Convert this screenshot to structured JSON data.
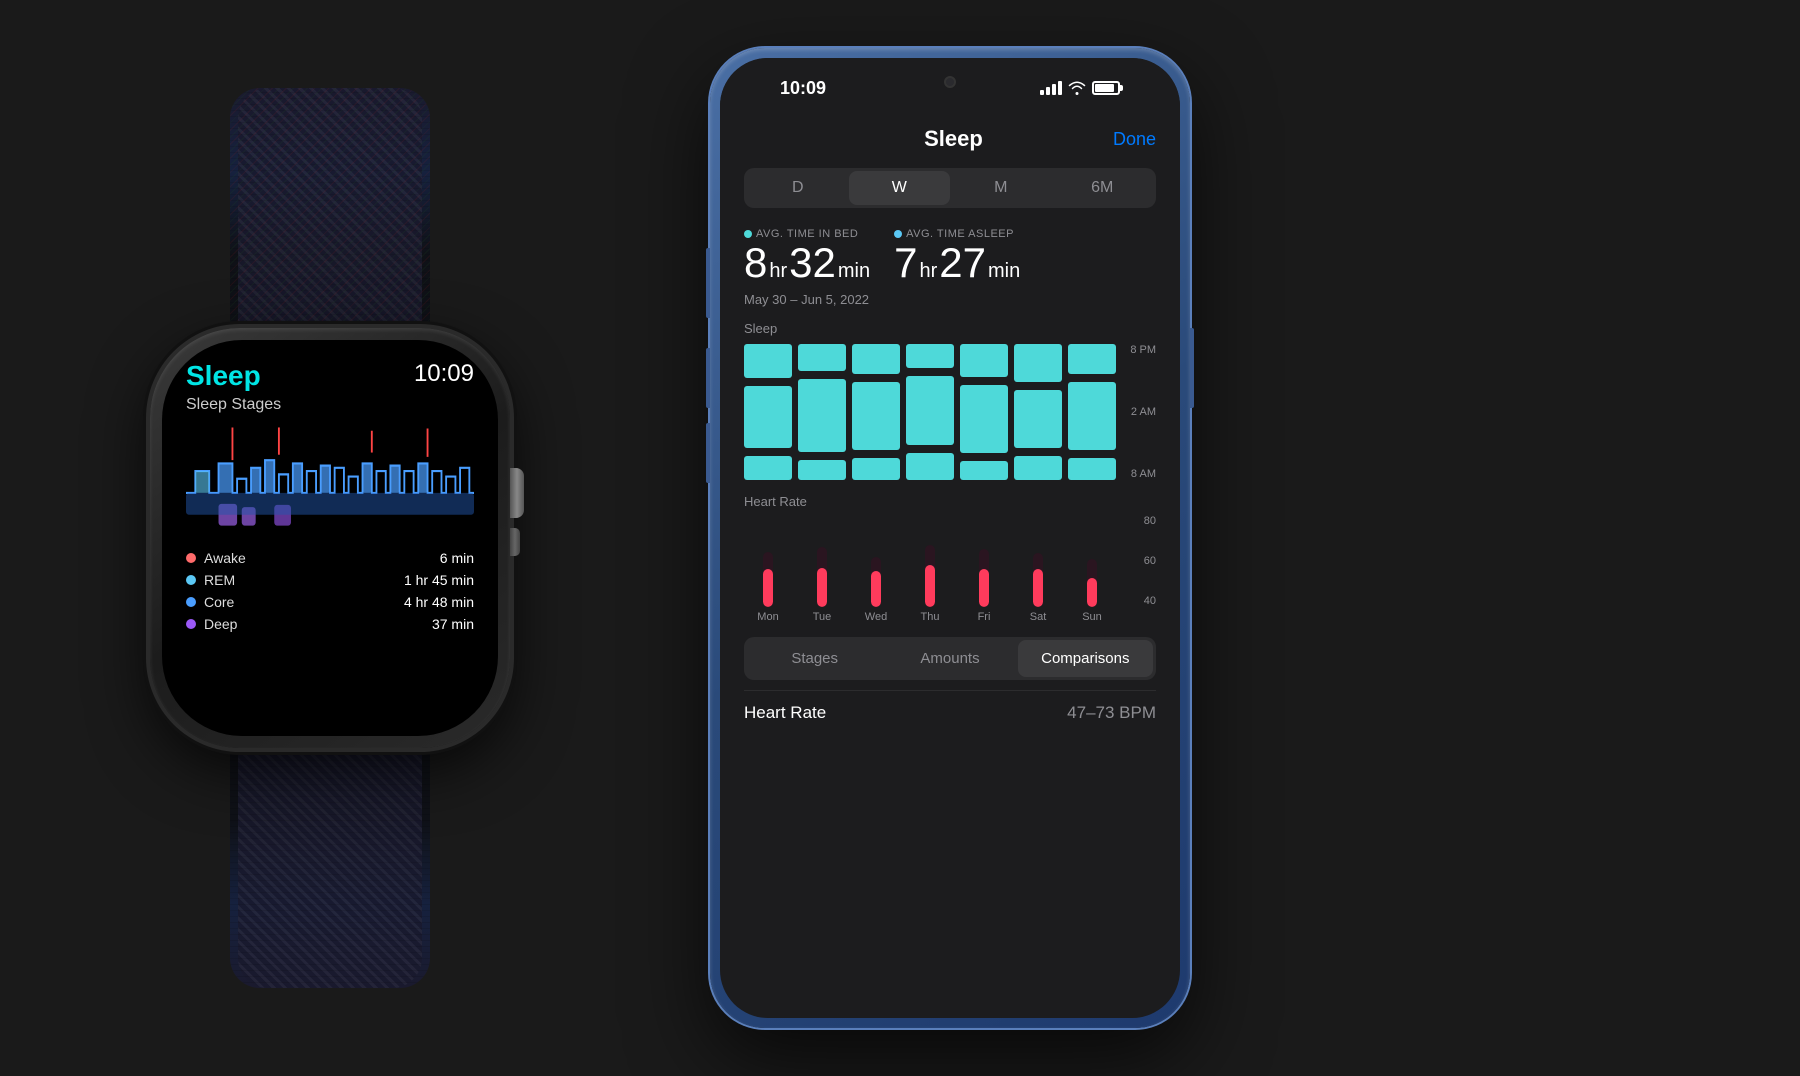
{
  "background": "#1a1a1a",
  "watch": {
    "title": "Sleep",
    "time": "10:09",
    "subtitle": "Sleep Stages",
    "legend": [
      {
        "id": "awake",
        "label": "Awake",
        "value": "6 min",
        "color": "#ff6b6b"
      },
      {
        "id": "rem",
        "label": "REM",
        "value": "1 hr 45 min",
        "color": "#5bc8f5"
      },
      {
        "id": "core",
        "label": "Core",
        "value": "4 hr 48 min",
        "color": "#4a9eff"
      },
      {
        "id": "deep",
        "label": "Deep",
        "value": "37 min",
        "color": "#9b59f7"
      }
    ]
  },
  "phone": {
    "status_time": "10:09",
    "nav_title": "Sleep",
    "nav_done": "Done",
    "segments": [
      "D",
      "W",
      "M",
      "6M"
    ],
    "active_segment": "W",
    "avg_time_in_bed_label": "AVG. TIME IN BED",
    "avg_time_in_bed_hr": "8",
    "avg_time_in_bed_min": "32",
    "avg_time_in_bed_unit_hr": "hr",
    "avg_time_in_bed_unit_min": "min",
    "avg_time_asleep_label": "AVG. TIME ASLEEP",
    "avg_time_asleep_hr": "7",
    "avg_time_asleep_min": "27",
    "avg_time_asleep_unit_hr": "hr",
    "avg_time_asleep_unit_min": "min",
    "dot_bed_color": "#4ed9d9",
    "dot_asleep_color": "#5bc8f5",
    "date_range": "May 30 – Jun 5, 2022",
    "sleep_chart_label": "Sleep",
    "hr_chart_label": "Heart Rate",
    "days": [
      "Mon",
      "Tue",
      "Wed",
      "Thu",
      "Fri",
      "Sat",
      "Sun"
    ],
    "sleep_y_labels": [
      "8 PM",
      "2 AM",
      "8 AM"
    ],
    "hr_y_labels": [
      "80",
      "60",
      "40"
    ],
    "bottom_tabs": [
      "Stages",
      "Amounts",
      "Comparisons"
    ],
    "active_bottom_tab": "Comparisons",
    "heart_rate_label": "Heart Rate",
    "heart_rate_value": "47–73 BPM"
  }
}
